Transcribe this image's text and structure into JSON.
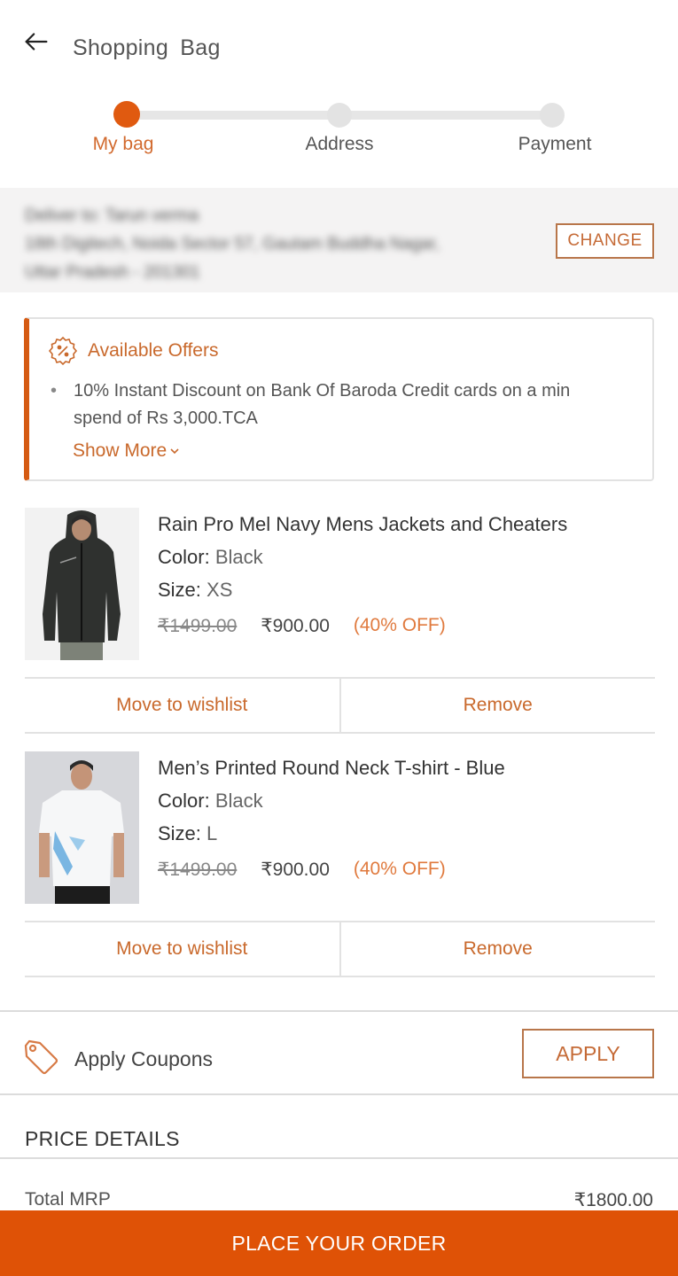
{
  "header": {
    "title": "Shopping  Bag",
    "back_icon": "arrow-left-icon"
  },
  "stepper": {
    "steps": [
      {
        "label": "My bag",
        "active": true
      },
      {
        "label": "Address",
        "active": false
      },
      {
        "label": "Payment",
        "active": false
      }
    ]
  },
  "delivery": {
    "line1": "Deliver to: Tarun verma",
    "line2": "18th Digitech, Noida Sector 57, Gautam Buddha Nagar,",
    "line3": "Uttar Pradesh - 201301",
    "change_label": "CHANGE"
  },
  "offers": {
    "icon": "discount-badge-icon",
    "title": "Available Offers",
    "items": [
      "10% Instant Discount on Bank Of Baroda Credit cards on a min spend of Rs 3,000.TCA"
    ],
    "show_more_label": "Show More"
  },
  "products": [
    {
      "name": "Rain Pro Mel Navy Mens Jackets and Cheaters",
      "color_label": "Color:",
      "color_value": "Black",
      "size_label": "Size:",
      "size_value": "XS",
      "mrp": "₹1499.00",
      "price": "₹900.00",
      "discount": "(40% OFF)",
      "wishlist_label": "Move to wishlist",
      "remove_label": "Remove"
    },
    {
      "name": "Men’s Printed Round Neck T-shirt - Blue",
      "color_label": "Color:",
      "color_value": "Black",
      "size_label": "Size:",
      "size_value": "L",
      "mrp": "₹1499.00",
      "price": "₹900.00",
      "discount": "(40% OFF)",
      "wishlist_label": "Move to wishlist",
      "remove_label": "Remove"
    }
  ],
  "coupons": {
    "icon": "tag-icon",
    "label": "Apply Coupons",
    "apply_label": "APPLY"
  },
  "price_details": {
    "title": "PRICE DETAILS",
    "rows": [
      {
        "label": "Total MRP",
        "value": "₹1800.00"
      }
    ]
  },
  "footer": {
    "place_order_label": "PLACE YOUR ORDER"
  },
  "colors": {
    "accent": "#df5206",
    "accent_text": "#c9692c",
    "discount_text": "#e07a3e"
  }
}
